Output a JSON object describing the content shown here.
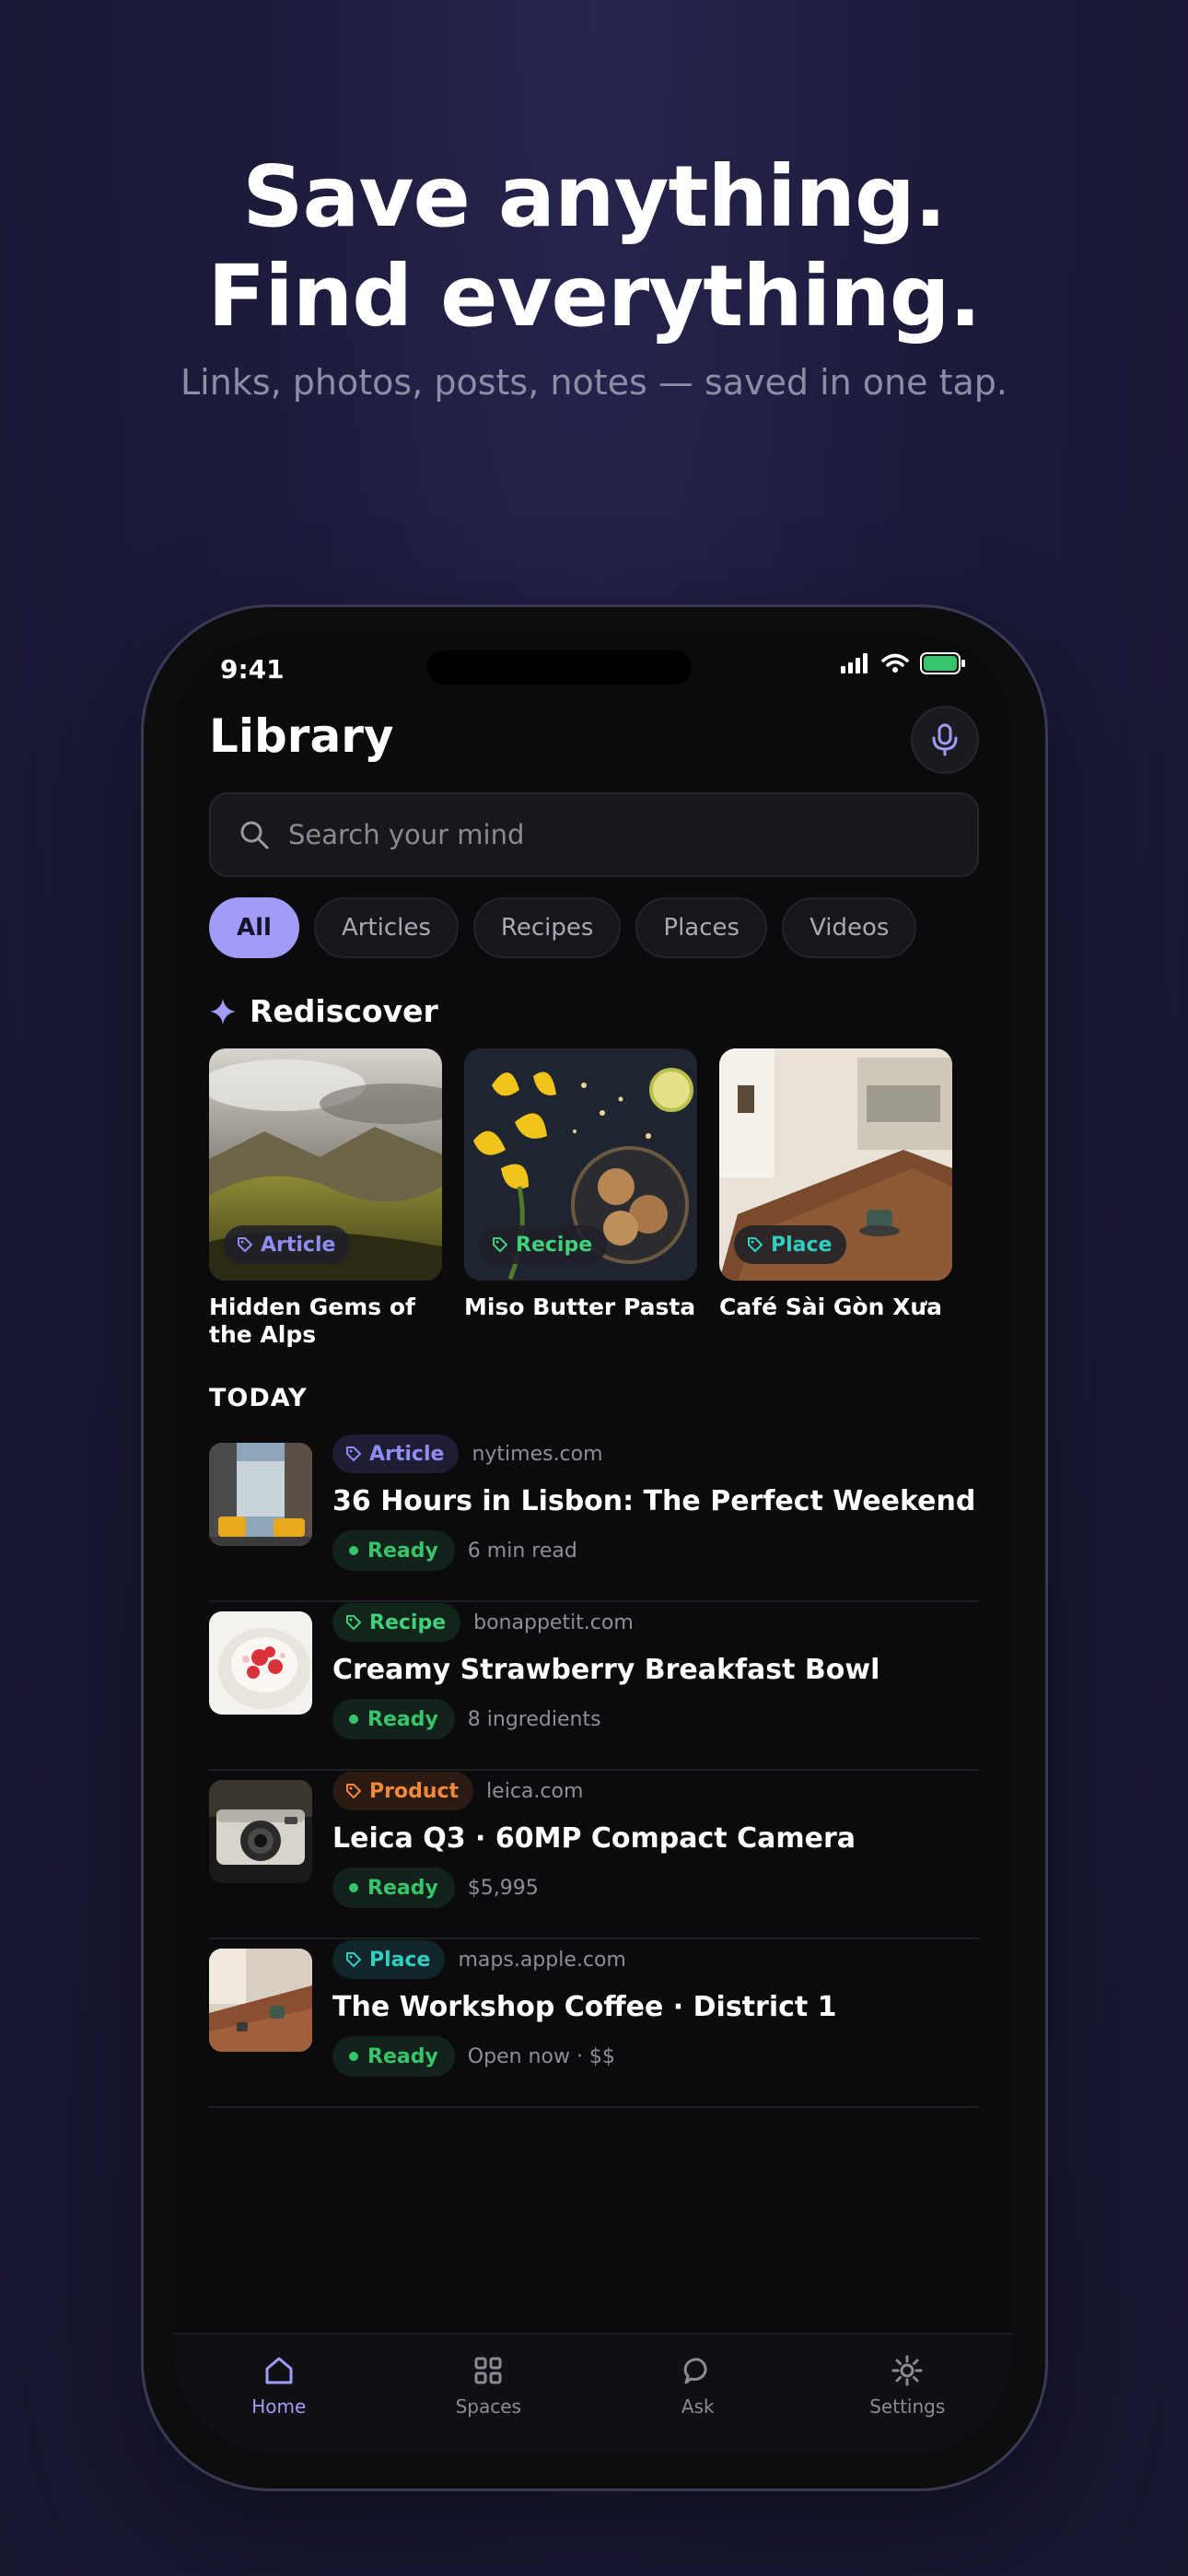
{
  "hero": {
    "line1": "Save anything.",
    "line2": "Find everything.",
    "subtitle": "Links, photos, posts, notes — saved in one tap."
  },
  "status_bar": {
    "time": "9:41"
  },
  "header": {
    "title": "Library"
  },
  "search": {
    "placeholder": "Search your mind"
  },
  "filters": [
    "All",
    "Articles",
    "Recipes",
    "Places",
    "Videos"
  ],
  "filters_active": "All",
  "rediscover": {
    "heading": "Rediscover",
    "cards": [
      {
        "tag": "Article",
        "title": "Hidden Gems of the Alps",
        "tag_color": "#8f8df0"
      },
      {
        "tag": "Recipe",
        "title": "Miso Butter Pasta",
        "tag_color": "#3fd07a"
      },
      {
        "tag": "Place",
        "title": "Café Sài Gòn Xưa",
        "tag_color": "#2fd0c0"
      }
    ]
  },
  "today": {
    "heading": "TODAY",
    "items": [
      {
        "tag": "Article",
        "domain": "nytimes.com",
        "title": "36 Hours in Lisbon: The Perfect Weekend",
        "status": "Ready",
        "detail": "6 min read"
      },
      {
        "tag": "Recipe",
        "domain": "bonappetit.com",
        "title": "Creamy Strawberry Breakfast Bowl",
        "status": "Ready",
        "detail": "8 ingredients"
      },
      {
        "tag": "Product",
        "domain": "leica.com",
        "title": "Leica Q3 · 60MP Compact Camera",
        "status": "Ready",
        "detail": "$5,995"
      },
      {
        "tag": "Place",
        "domain": "maps.apple.com",
        "title": "The Workshop Coffee · District 1",
        "status": "Ready",
        "detail": "Open now · $$"
      }
    ]
  },
  "tabbar": [
    "Home",
    "Spaces",
    "Ask",
    "Settings"
  ],
  "tabbar_active": "Home",
  "colors": {
    "accent": "#a19cf6",
    "article": "#8f8df0",
    "recipe": "#3fd07a",
    "product": "#f2893a",
    "place": "#2fd0c0",
    "ready": "#37c46b"
  }
}
